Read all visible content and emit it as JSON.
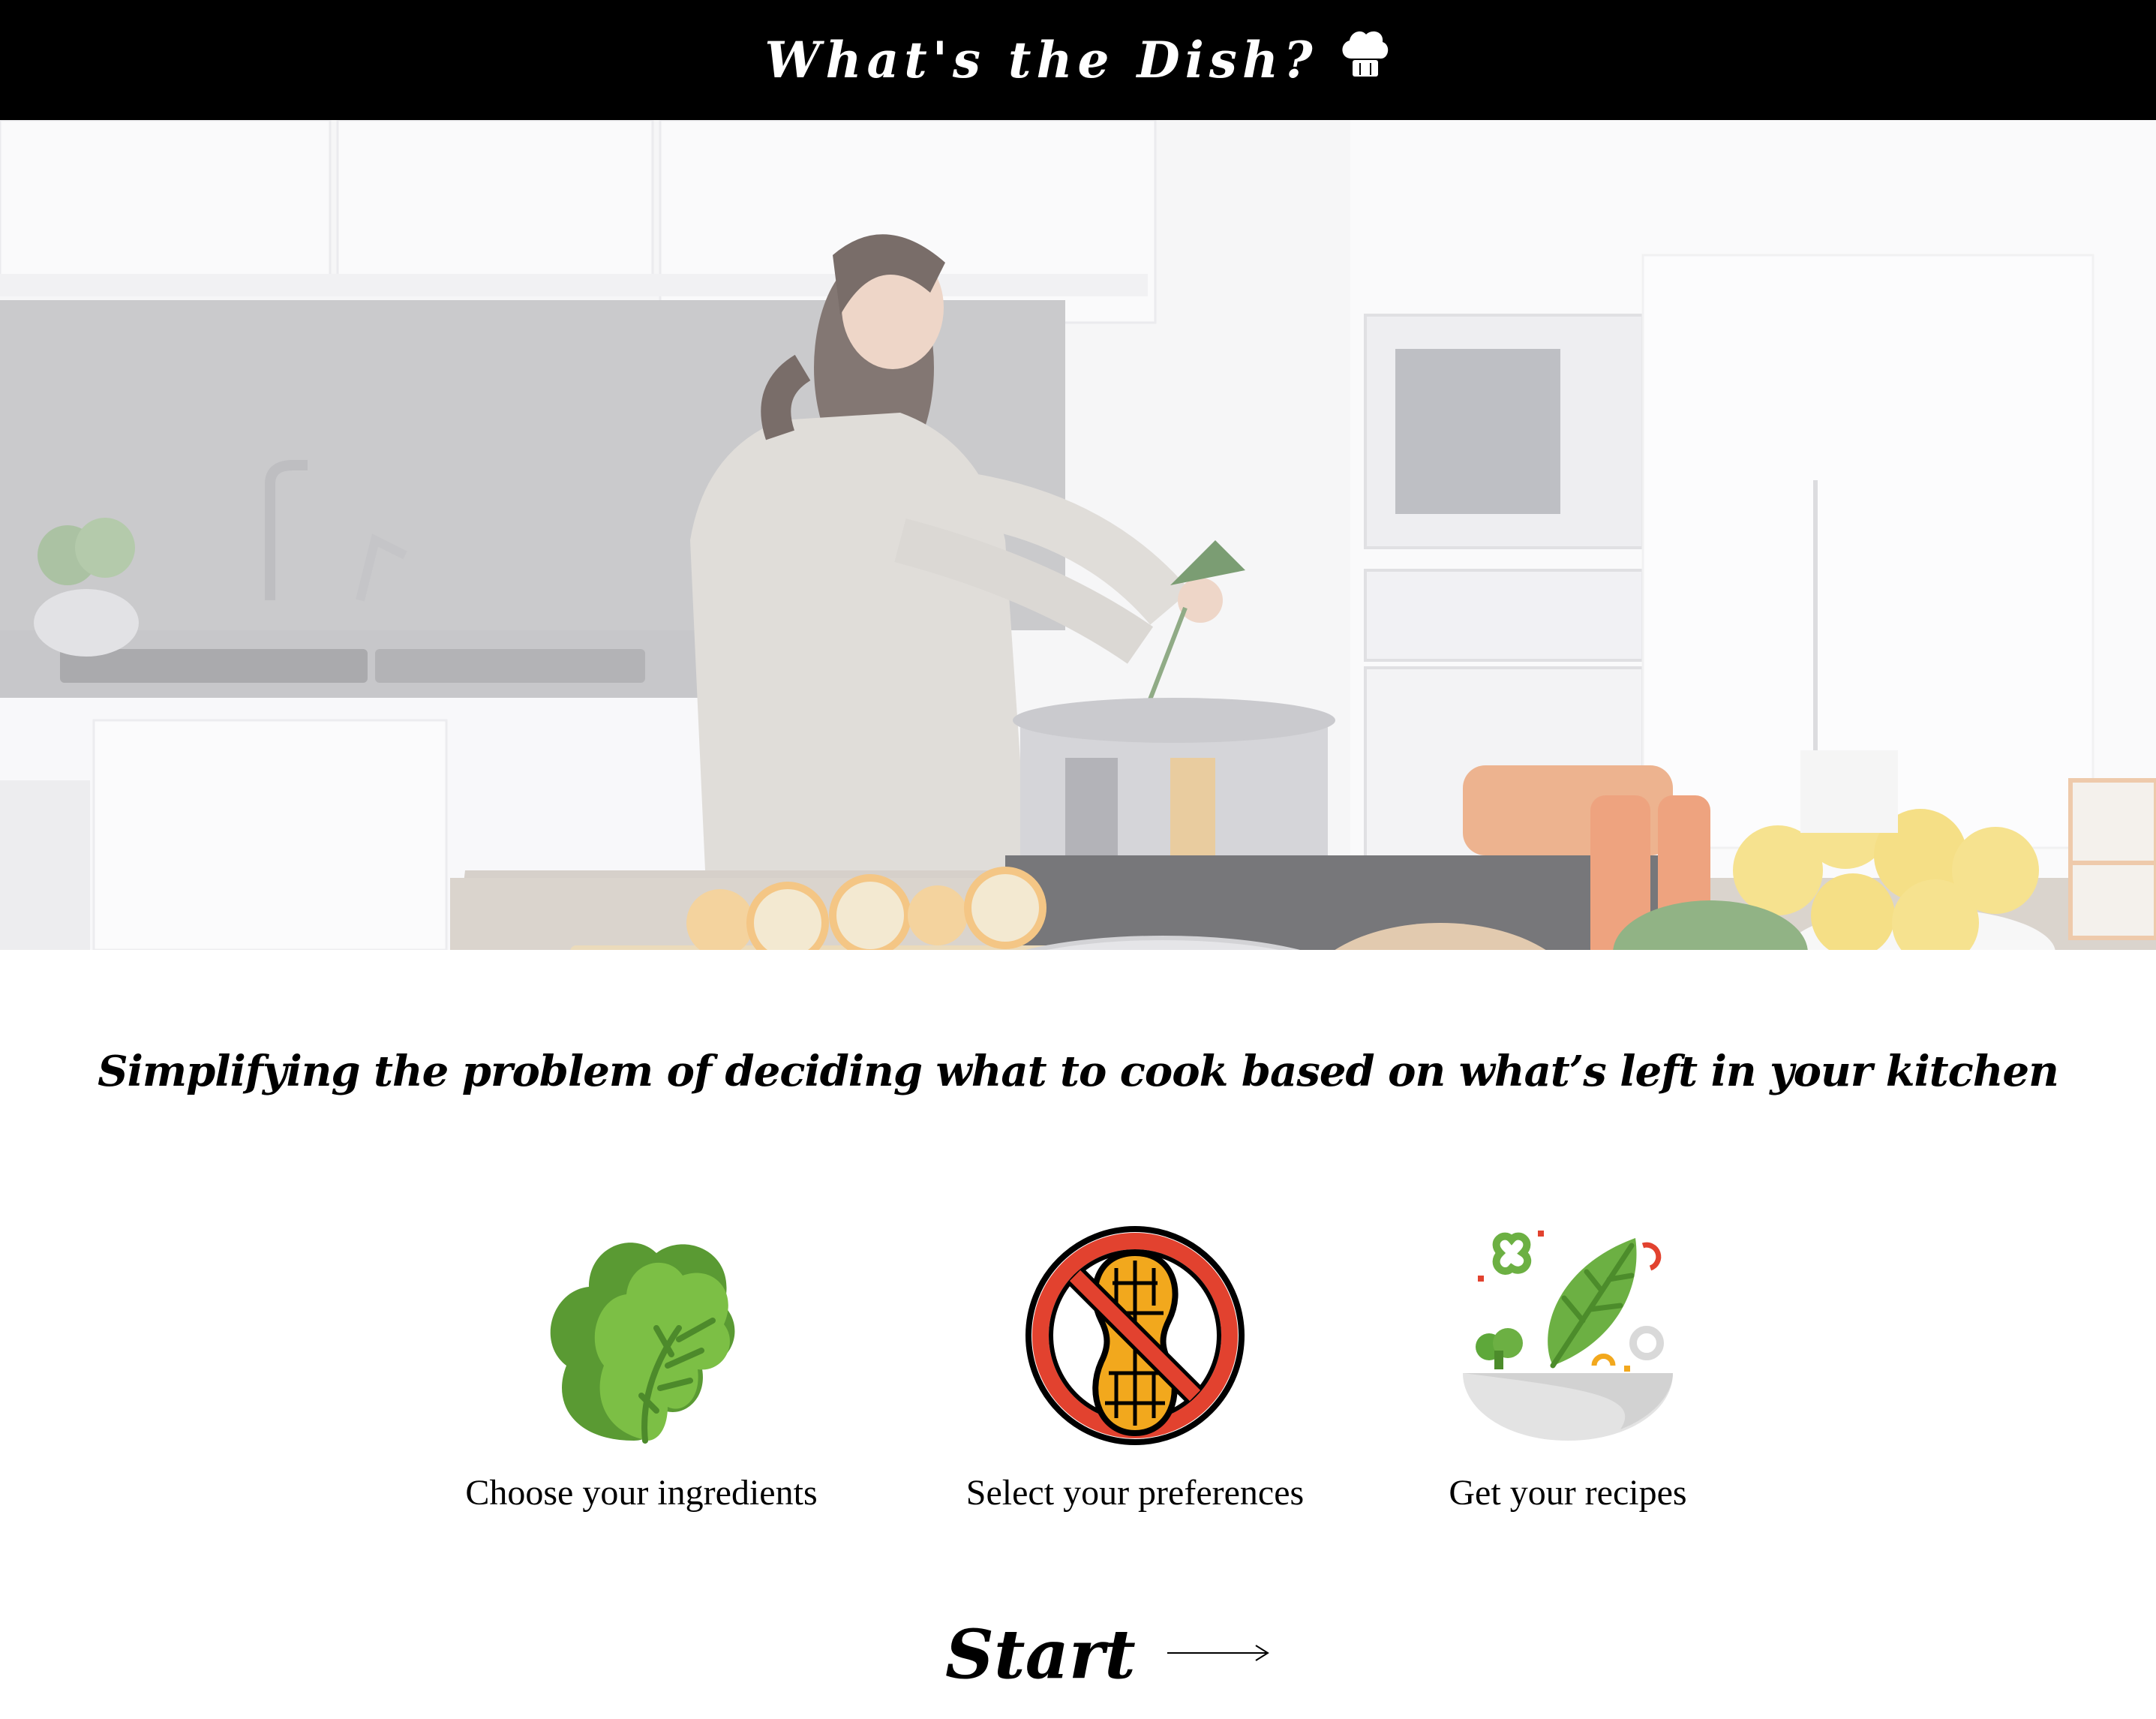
{
  "header": {
    "title": "What's the Dish?",
    "icon": "chef-hat-icon"
  },
  "hero": {
    "image": "kitchen-cooking-photo"
  },
  "tagline": "Simplifying the problem of deciding what to cook based on what’s left in your kitchen",
  "features": [
    {
      "label": "Choose your ingredients",
      "icon": "lettuce-icon"
    },
    {
      "label": "Select your preferences",
      "icon": "no-peanut-icon"
    },
    {
      "label": "Get your recipes",
      "icon": "salad-bowl-icon"
    }
  ],
  "cta": {
    "label": "Start",
    "icon": "arrow-right-icon"
  },
  "colors": {
    "topbar": "#000000",
    "text": "#000000",
    "lettuce_green": "#6db33f",
    "no_sign_red": "#e2422f",
    "peanut_yellow": "#f2a81d"
  }
}
